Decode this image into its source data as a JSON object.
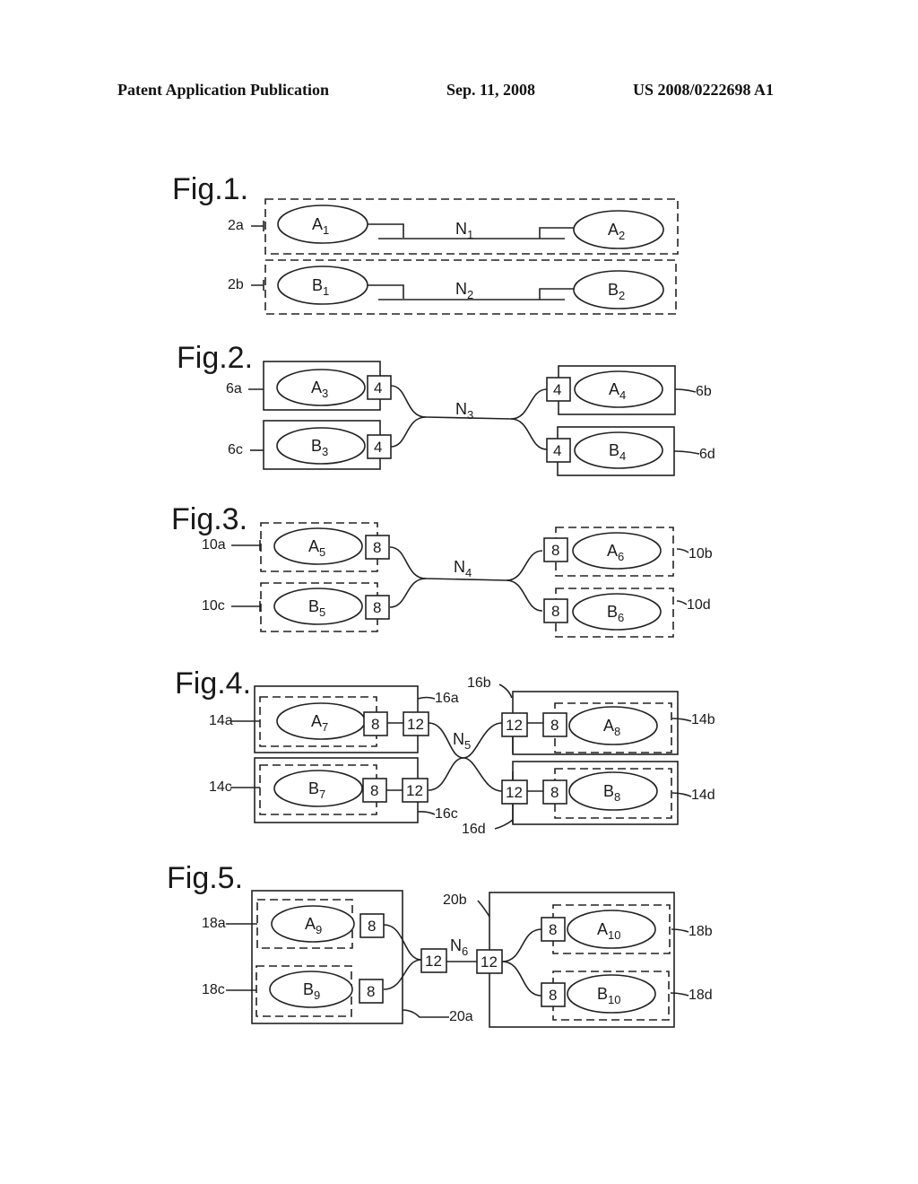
{
  "header": {
    "left": "Patent Application Publication",
    "date": "Sep. 11, 2008",
    "number": "US 2008/0222698 A1"
  },
  "figures": [
    {
      "label": "Fig.1.",
      "refs": [
        "2a",
        "2b"
      ],
      "nodes": [
        {
          "base": "A",
          "sub": "1"
        },
        {
          "base": "A",
          "sub": "2"
        },
        {
          "base": "B",
          "sub": "1"
        },
        {
          "base": "B",
          "sub": "2"
        }
      ],
      "networks": [
        {
          "base": "N",
          "sub": "1"
        },
        {
          "base": "N",
          "sub": "2"
        }
      ]
    },
    {
      "label": "Fig.2.",
      "refs": [
        "6a",
        "6b",
        "6c",
        "6d"
      ],
      "nodes": [
        {
          "base": "A",
          "sub": "3"
        },
        {
          "base": "A",
          "sub": "4"
        },
        {
          "base": "B",
          "sub": "3"
        },
        {
          "base": "B",
          "sub": "4"
        }
      ],
      "box_number": "4",
      "network": {
        "base": "N",
        "sub": "3"
      }
    },
    {
      "label": "Fig.3.",
      "refs": [
        "10a",
        "10b",
        "10c",
        "10d"
      ],
      "nodes": [
        {
          "base": "A",
          "sub": "5"
        },
        {
          "base": "A",
          "sub": "6"
        },
        {
          "base": "B",
          "sub": "5"
        },
        {
          "base": "B",
          "sub": "6"
        }
      ],
      "box_number": "8",
      "network": {
        "base": "N",
        "sub": "4"
      }
    },
    {
      "label": "Fig.4.",
      "refs": [
        "14a",
        "14b",
        "14c",
        "14d",
        "16a",
        "16b",
        "16c",
        "16d"
      ],
      "nodes": [
        {
          "base": "A",
          "sub": "7"
        },
        {
          "base": "A",
          "sub": "8"
        },
        {
          "base": "B",
          "sub": "7"
        },
        {
          "base": "B",
          "sub": "8"
        }
      ],
      "inner_box_number": "8",
      "outer_box_number": "12",
      "network": {
        "base": "N",
        "sub": "5"
      }
    },
    {
      "label": "Fig.5.",
      "refs": [
        "18a",
        "18b",
        "18c",
        "18d",
        "20a",
        "20b"
      ],
      "nodes": [
        {
          "base": "A",
          "sub": "9"
        },
        {
          "base": "A",
          "sub": "10"
        },
        {
          "base": "B",
          "sub": "9"
        },
        {
          "base": "B",
          "sub": "10"
        }
      ],
      "inner_box_number": "8",
      "outer_box_number": "12",
      "network": {
        "base": "N",
        "sub": "6"
      }
    }
  ]
}
